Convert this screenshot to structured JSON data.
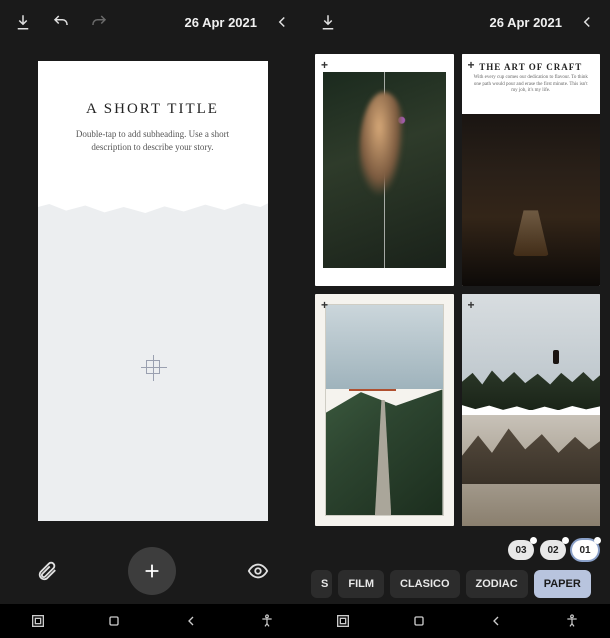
{
  "left": {
    "date": "26 Apr 2021",
    "canvas": {
      "title": "A SHORT TITLE",
      "subtitle": "Double-tap to add subheading. Use a short description to describe your story."
    }
  },
  "right": {
    "date": "26 Apr 2021",
    "templates": {
      "t2": {
        "title": "THE ART OF CRAFT",
        "subtitle": "With every cup comes our dedication to flavour. To think one path would pour and erase the first minute. This isn't my job, it's my life."
      }
    },
    "pages": [
      "01",
      "02",
      "03"
    ],
    "active_page": "01",
    "filters": [
      "S",
      "FILM",
      "CLASICO",
      "ZODIAC",
      "PAPER"
    ],
    "active_filter": "PAPER"
  }
}
